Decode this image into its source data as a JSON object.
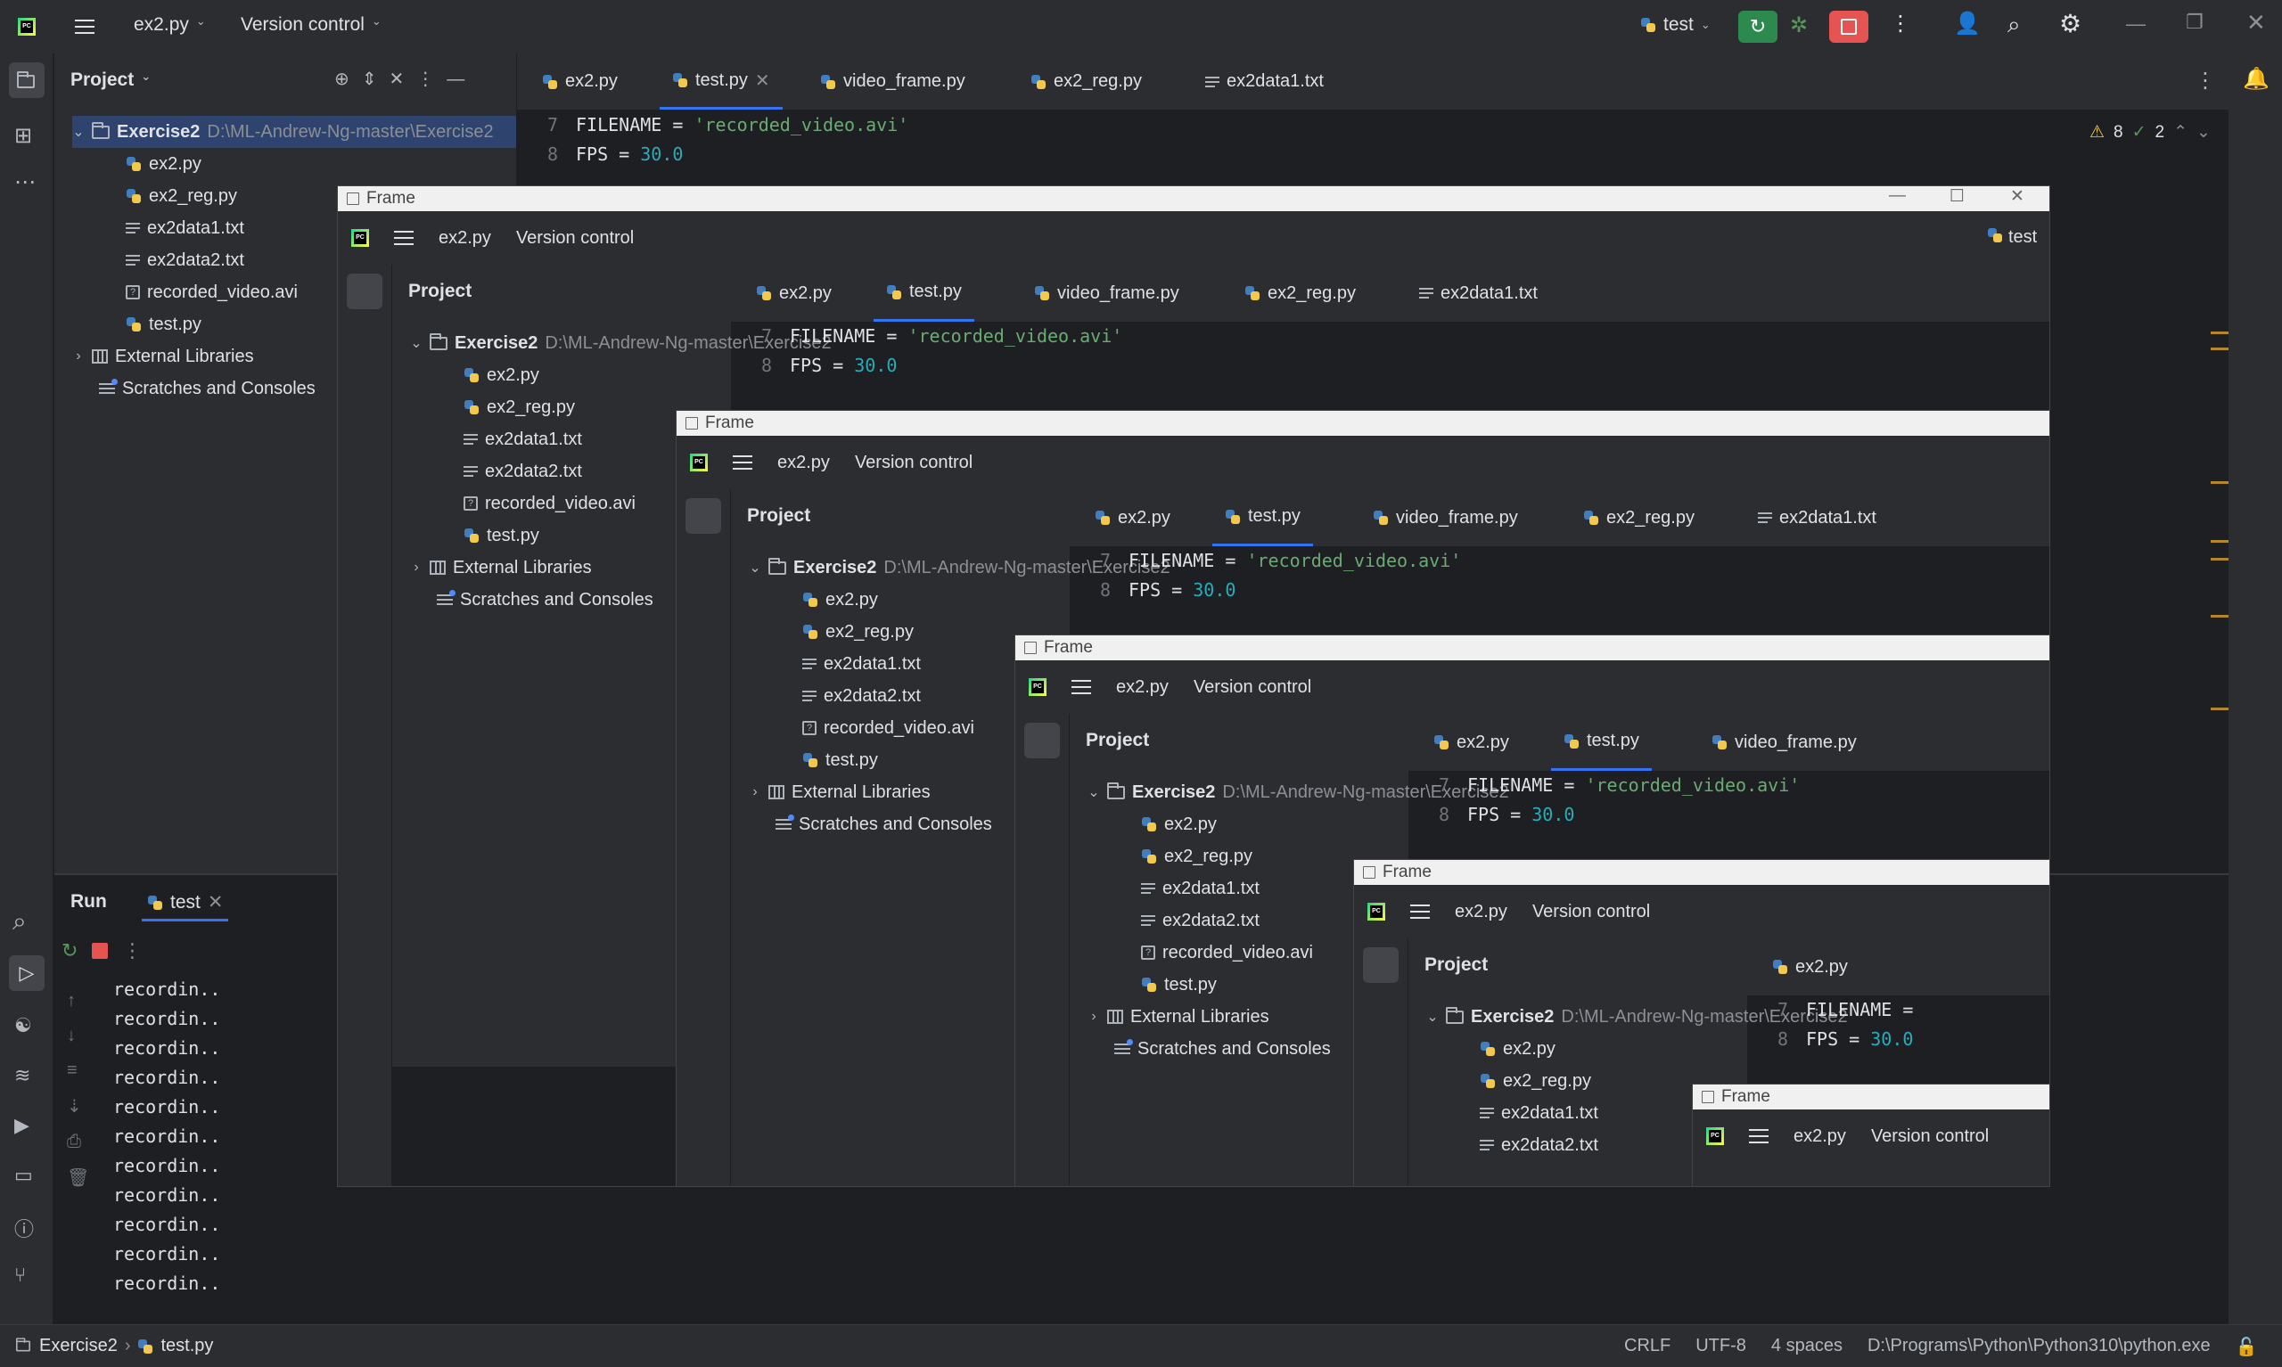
{
  "main": {
    "toolbar": {
      "project_file": "ex2.py",
      "vcs": "Version control",
      "run_config": "test"
    },
    "project_panel": {
      "title": "Project",
      "root": {
        "name": "Exercise2",
        "path": "D:\\ML-Andrew-Ng-master\\Exercise2"
      },
      "files": [
        "ex2.py",
        "ex2_reg.py",
        "ex2data1.txt",
        "ex2data2.txt",
        "recorded_video.avi",
        "test.py"
      ],
      "external_libraries": "External Libraries",
      "scratches": "Scratches and Consoles"
    },
    "tabs": [
      "ex2.py",
      "test.py",
      "video_frame.py",
      "ex2_reg.py",
      "ex2data1.txt"
    ],
    "editor": {
      "line7_no": "7",
      "line8_no": "8",
      "line7_a": "FILENAME = ",
      "line7_b": "'recorded_video.avi'",
      "line8_a": "FPS = ",
      "line8_b": "30.0",
      "warnings": "8",
      "oks": "2"
    },
    "run": {
      "title": "Run",
      "tab": "test",
      "output": [
        "recordin..",
        "recordin..",
        "recordin..",
        "recordin..",
        "recordin..",
        "recordin..",
        "recordin..",
        "recordin..",
        "recordin..",
        "recordin..",
        "recordin.."
      ]
    },
    "status": {
      "crumb1": "Exercise2",
      "crumb2": "test.py",
      "line_sep": "CRLF",
      "encoding": "UTF-8",
      "indent": "4 spaces",
      "interpreter": "D:\\Programs\\Python\\Python310\\python.exe"
    }
  },
  "frame_window": {
    "title": "Frame"
  },
  "colors": {
    "accent": "#3574f0",
    "run_green": "#2d8a4e",
    "stop_red": "#e55353",
    "string": "#6aab73",
    "number": "#2aacb8"
  }
}
